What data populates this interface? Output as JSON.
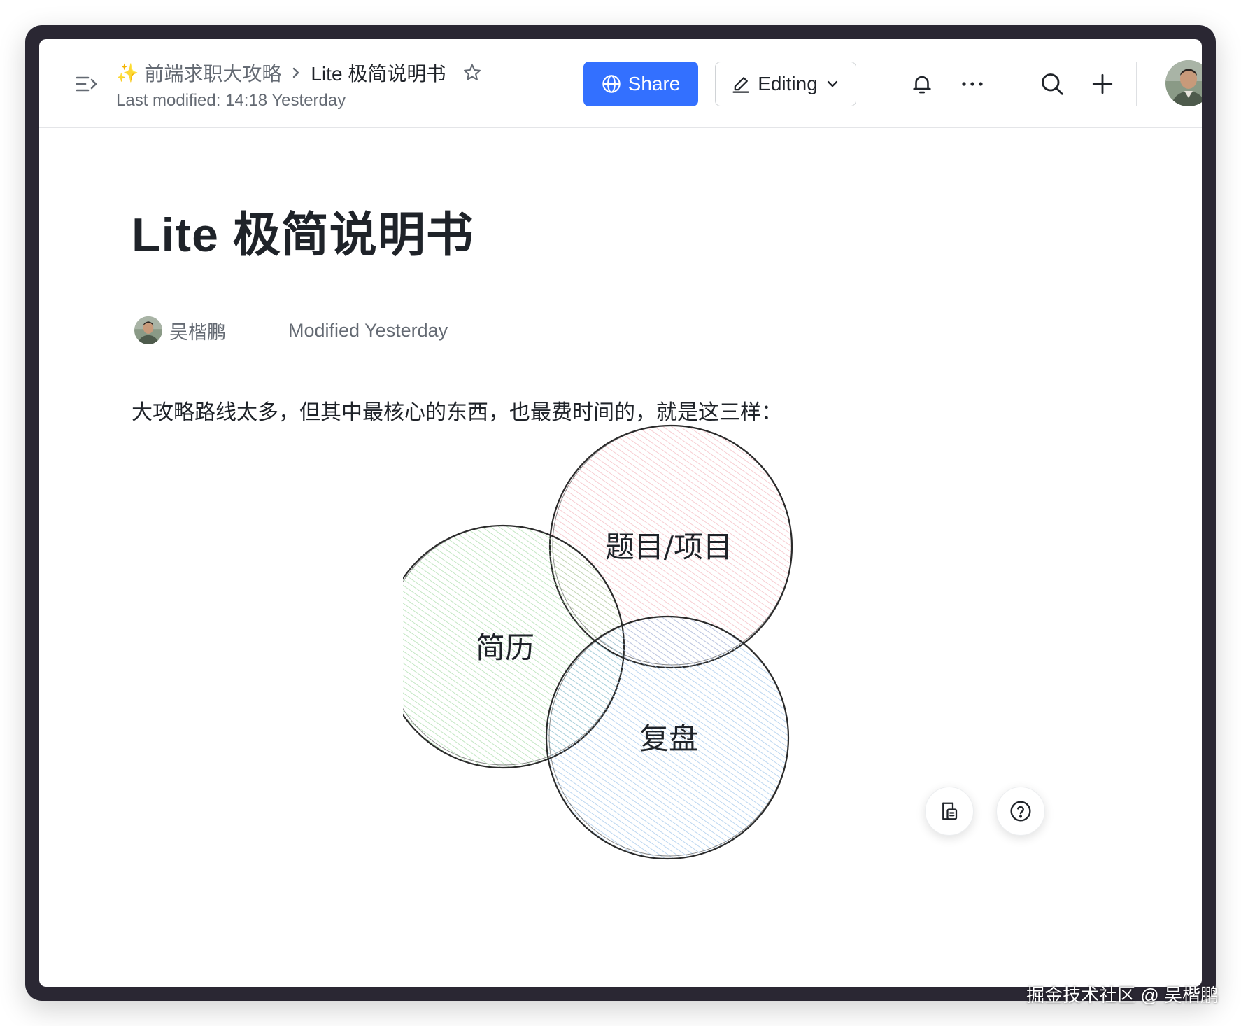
{
  "header": {
    "breadcrumb_parent": "前端求职大攻略",
    "breadcrumb_current": "Lite 极简说明书",
    "last_modified": "Last modified: 14:18 Yesterday",
    "share_label": "Share",
    "editing_label": "Editing"
  },
  "doc": {
    "title": "Lite 极简说明书",
    "author": "吴楷鹏",
    "modified": "Modified Yesterday",
    "paragraph": "大攻略路线太多，但其中最核心的东西，也最费时间的，就是这三样："
  },
  "diagram": {
    "circles": [
      {
        "label": "题目/项目",
        "color": "#f4b6bd"
      },
      {
        "label": "简历",
        "color": "#a8dca8"
      },
      {
        "label": "复盘",
        "color": "#9ec4ea"
      }
    ]
  },
  "colors": {
    "accent": "#3370ff",
    "text_primary": "#1f2329",
    "text_secondary": "#646a73",
    "frame": "#2a2733"
  },
  "icons": {
    "sidebar_toggle": "sidebar-toggle-icon",
    "sparkle": "sparkle-icon",
    "chevron_right": "chevron-right-icon",
    "star": "star-icon",
    "globe": "globe-icon",
    "pencil": "pencil-icon",
    "chevron_down": "chevron-down-icon",
    "bell": "bell-icon",
    "more": "more-icon",
    "search": "search-icon",
    "plus": "plus-icon",
    "document": "document-icon",
    "help": "help-icon"
  },
  "watermark": "掘金技术社区 @ 吴楷鹏"
}
